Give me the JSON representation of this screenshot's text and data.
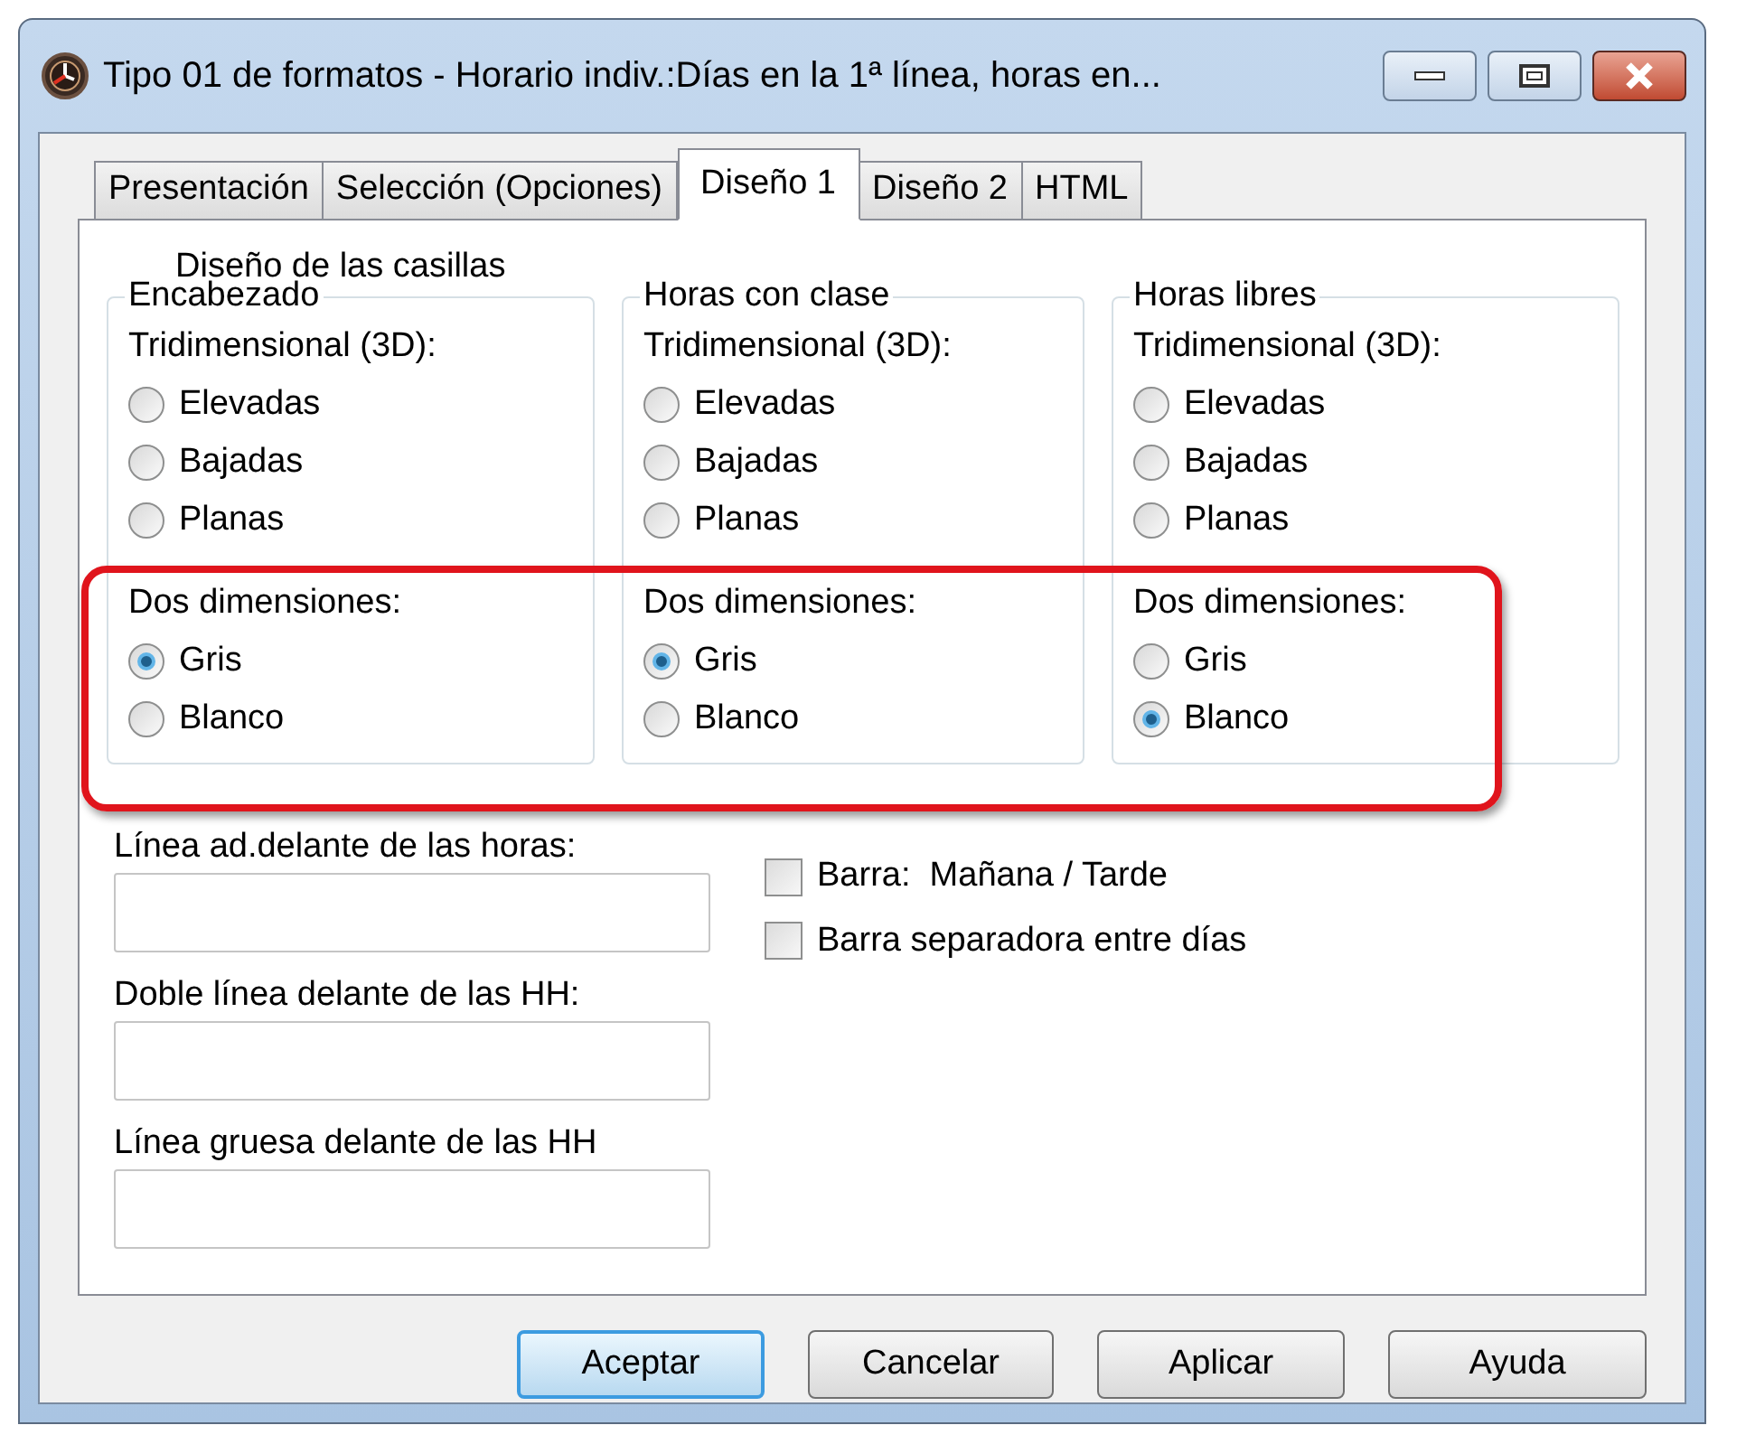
{
  "window": {
    "title": "Tipo 01 de formatos - Horario indiv.:Días en la 1ª línea, horas en..."
  },
  "tabs": [
    {
      "label": "Presentación",
      "selected": false
    },
    {
      "label": "Selección (Opciones)",
      "selected": false
    },
    {
      "label": "Diseño 1",
      "selected": true
    },
    {
      "label": "Diseño 2",
      "selected": false
    },
    {
      "label": "HTML",
      "selected": false
    }
  ],
  "section_title": "Diseño de las casillas",
  "groups": [
    {
      "title": "Encabezado",
      "label_3d": "Tridimensional (3D):",
      "options_3d": [
        {
          "label": "Elevadas",
          "selected": false
        },
        {
          "label": "Bajadas",
          "selected": false
        },
        {
          "label": "Planas",
          "selected": false
        }
      ],
      "label_2d": "Dos dimensiones:",
      "options_2d": [
        {
          "label": "Gris",
          "selected": true
        },
        {
          "label": "Blanco",
          "selected": false
        }
      ]
    },
    {
      "title": "Horas con clase",
      "label_3d": "Tridimensional (3D):",
      "options_3d": [
        {
          "label": "Elevadas",
          "selected": false
        },
        {
          "label": "Bajadas",
          "selected": false
        },
        {
          "label": "Planas",
          "selected": false
        }
      ],
      "label_2d": "Dos dimensiones:",
      "options_2d": [
        {
          "label": "Gris",
          "selected": true
        },
        {
          "label": "Blanco",
          "selected": false
        }
      ]
    },
    {
      "title": "Horas libres",
      "label_3d": "Tridimensional (3D):",
      "options_3d": [
        {
          "label": "Elevadas",
          "selected": false
        },
        {
          "label": "Bajadas",
          "selected": false
        },
        {
          "label": "Planas",
          "selected": false
        }
      ],
      "label_2d": "Dos dimensiones:",
      "options_2d": [
        {
          "label": "Gris",
          "selected": false
        },
        {
          "label": "Blanco",
          "selected": true
        }
      ]
    }
  ],
  "fields": [
    {
      "label": "Línea ad.delante de las horas:"
    },
    {
      "label": "Doble línea delante de las HH:"
    },
    {
      "label": "Línea gruesa delante de las HH"
    }
  ],
  "checkboxes": [
    {
      "label": "Barra:  Mañana / Tarde",
      "checked": false
    },
    {
      "label": "Barra separadora entre días",
      "checked": false
    }
  ],
  "buttons": [
    {
      "label": "Aceptar",
      "default": true
    },
    {
      "label": "Cancelar",
      "default": false
    },
    {
      "label": "Aplicar",
      "default": false
    },
    {
      "label": "Ayuda",
      "default": false
    }
  ]
}
